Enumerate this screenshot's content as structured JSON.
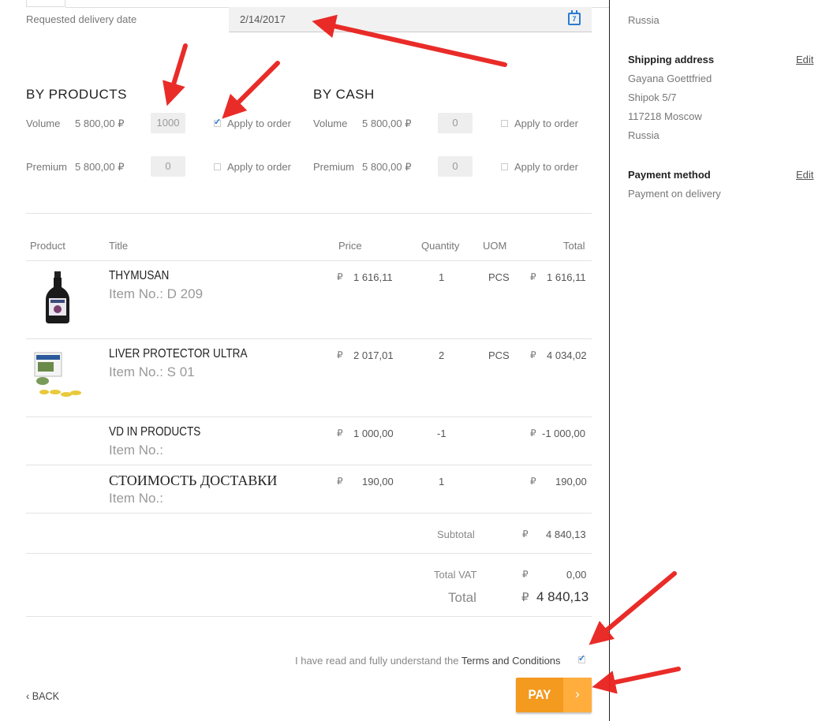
{
  "delivery": {
    "label": "Requested delivery date",
    "value": "2/14/2017"
  },
  "by_products": {
    "heading": "BY PRODUCTS",
    "volume": {
      "label": "Volume",
      "amount": "5 800,00 ₽",
      "input": "1000",
      "apply_label": "Apply to order",
      "checked": true
    },
    "premium": {
      "label": "Premium",
      "amount": "5 800,00 ₽",
      "input": "0",
      "apply_label": "Apply to order",
      "checked": false
    }
  },
  "by_cash": {
    "heading": "BY CASH",
    "volume": {
      "label": "Volume",
      "amount": "5 800,00 ₽",
      "input": "0",
      "apply_label": "Apply to order",
      "checked": false
    },
    "premium": {
      "label": "Premium",
      "amount": "5 800,00 ₽",
      "input": "0",
      "apply_label": "Apply to order",
      "checked": false
    }
  },
  "table": {
    "headers": {
      "product": "Product",
      "title": "Title",
      "price": "Price",
      "quantity": "Quantity",
      "uom": "UOM",
      "total": "Total"
    },
    "currency": "₽",
    "rows": [
      {
        "title": "THYMUSAN",
        "item_no": "Item No.: D 209",
        "price": "1 616,11",
        "quantity": "1",
        "uom": "PCS",
        "total": "1 616,11"
      },
      {
        "title": "LIVER PROTECTOR ULTRA",
        "item_no": "Item No.: S 01",
        "price": "2 017,01",
        "quantity": "2",
        "uom": "PCS",
        "total": "4 034,02"
      },
      {
        "title": "VD IN PRODUCTS",
        "item_no": "Item No.:",
        "price": "1 000,00",
        "quantity": "-1",
        "uom": "",
        "total": "-1 000,00"
      },
      {
        "title": "СТОИМОСТЬ ДОСТАВКИ",
        "item_no": "Item No.:",
        "price": "190,00",
        "quantity": "1",
        "uom": "",
        "total": "190,00"
      }
    ],
    "subtotal_label": "Subtotal",
    "subtotal": "4 840,13",
    "vat_label": "Total VAT",
    "vat": "0,00",
    "total_label": "Total",
    "total": "4 840,13"
  },
  "terms": {
    "prefix": "I have read and fully understand the ",
    "link": "Terms and Conditions",
    "checked": true
  },
  "buttons": {
    "back": "BACK",
    "pay": "PAY",
    "pay_chevron": "›",
    "back_chevron": "‹"
  },
  "sidebar": {
    "billing_country": "Russia",
    "shipping": {
      "heading": "Shipping address",
      "edit": "Edit",
      "lines": [
        "Gayana Goettfried",
        "Shipok 5/7",
        "117218 Moscow",
        "Russia"
      ]
    },
    "payment": {
      "heading": "Payment method",
      "edit": "Edit",
      "value": "Payment on delivery"
    }
  },
  "icons": {
    "calendar": "calendar-icon",
    "calendar_day": "7"
  },
  "colors": {
    "accent_orange": "#f39a1f",
    "annotation_red": "#e8211d",
    "link_blue": "#2a7bd2"
  }
}
